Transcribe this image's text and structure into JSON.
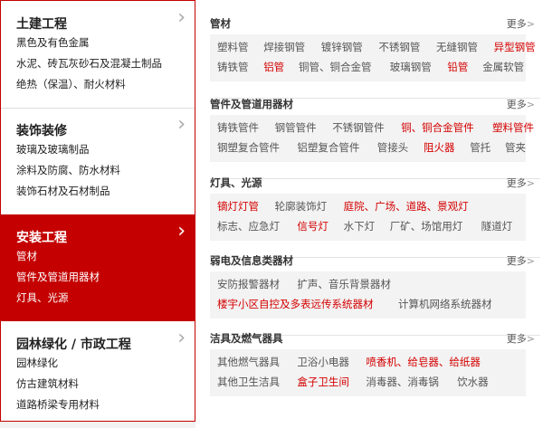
{
  "menu": {
    "categories": [
      {
        "title": "土建工程",
        "subs": [
          "黑色及有色金属",
          "水泥、砖瓦灰砂石及混凝土制品",
          "绝热（保温）、耐火材料"
        ]
      },
      {
        "title": "装饰装修",
        "subs": [
          "玻璃及玻璃制品",
          "涂料及防腐、防水材料",
          "装饰石材及石材制品"
        ]
      },
      {
        "title": "安装工程",
        "subs": [
          "管材",
          "管件及管道用器材",
          "灯具、光源"
        ]
      },
      {
        "title": "园林绿化 / 市政工程",
        "subs": [
          "园林绿化",
          "仿古建筑材料",
          "道路桥梁专用材料"
        ]
      }
    ],
    "chevron": "chevron-right-icon"
  },
  "panel": {
    "more_label": "更多",
    "more_arrow": ">",
    "sections": [
      {
        "head": "管材",
        "rows": [
          [
            {
              "t": "塑料管",
              "red": false
            },
            {
              "t": "焊接钢管",
              "red": false
            },
            {
              "t": "镀锌钢管",
              "red": false
            },
            {
              "t": "不锈钢管",
              "red": false
            },
            {
              "t": "无缝钢管",
              "red": false
            },
            {
              "t": "异型钢管",
              "red": true
            }
          ],
          [
            {
              "t": "铸铁管",
              "red": false
            },
            {
              "t": "铝管",
              "red": true
            },
            {
              "t": "铜管、铜合金管",
              "red": false
            },
            {
              "t": "玻璃钢管",
              "red": false
            },
            {
              "t": "铅管",
              "red": true
            },
            {
              "t": "金属软管",
              "red": false
            }
          ]
        ]
      },
      {
        "head": "管件及管道用器材",
        "rows": [
          [
            {
              "t": "铸铁管件",
              "red": false
            },
            {
              "t": "钢管管件",
              "red": false
            },
            {
              "t": "不锈钢管件",
              "red": false
            },
            {
              "t": "铜、铜合金管件",
              "red": true
            },
            {
              "t": "塑料管件",
              "red": true
            }
          ],
          [
            {
              "t": "钢塑复合管件",
              "red": false
            },
            {
              "t": "铝塑复合管件",
              "red": false
            },
            {
              "t": "管接头",
              "red": false
            },
            {
              "t": "阻火器",
              "red": true
            },
            {
              "t": "管托",
              "red": false
            },
            {
              "t": "管夹",
              "red": false
            }
          ]
        ]
      },
      {
        "head": "灯具、光源",
        "rows": [
          [
            {
              "t": "镝灯灯管",
              "red": true
            },
            {
              "t": "轮廓装饰灯",
              "red": false
            },
            {
              "t": "庭院、广场、道路、景观灯",
              "red": true
            }
          ],
          [
            {
              "t": "标志、应急灯",
              "red": false
            },
            {
              "t": "信号灯",
              "red": true
            },
            {
              "t": "水下灯",
              "red": false
            },
            {
              "t": "厂矿、场馆用灯",
              "red": false
            },
            {
              "t": "隧道灯",
              "red": false
            }
          ]
        ]
      },
      {
        "head": "弱电及信息类器材",
        "rows": [
          [
            {
              "t": "安防报警器材",
              "red": false
            },
            {
              "t": "扩声、音乐背景器材",
              "red": false
            }
          ],
          [
            {
              "t": "楼宇小区自控及多表远传系统器材",
              "red": true
            },
            {
              "t": "计算机网络系统器材",
              "red": false
            }
          ]
        ]
      },
      {
        "head": "洁具及燃气器具",
        "rows": [
          [
            {
              "t": "其他燃气器具",
              "red": false
            },
            {
              "t": "卫浴小电器",
              "red": false
            },
            {
              "t": "喷香机、给皂器、给纸器",
              "red": true
            }
          ],
          [
            {
              "t": "其他卫生洁具",
              "red": false
            },
            {
              "t": "盒子卫生间",
              "red": true
            },
            {
              "t": "消毒器、消毒锅",
              "red": false
            },
            {
              "t": "饮水器",
              "red": false
            }
          ]
        ]
      }
    ]
  }
}
